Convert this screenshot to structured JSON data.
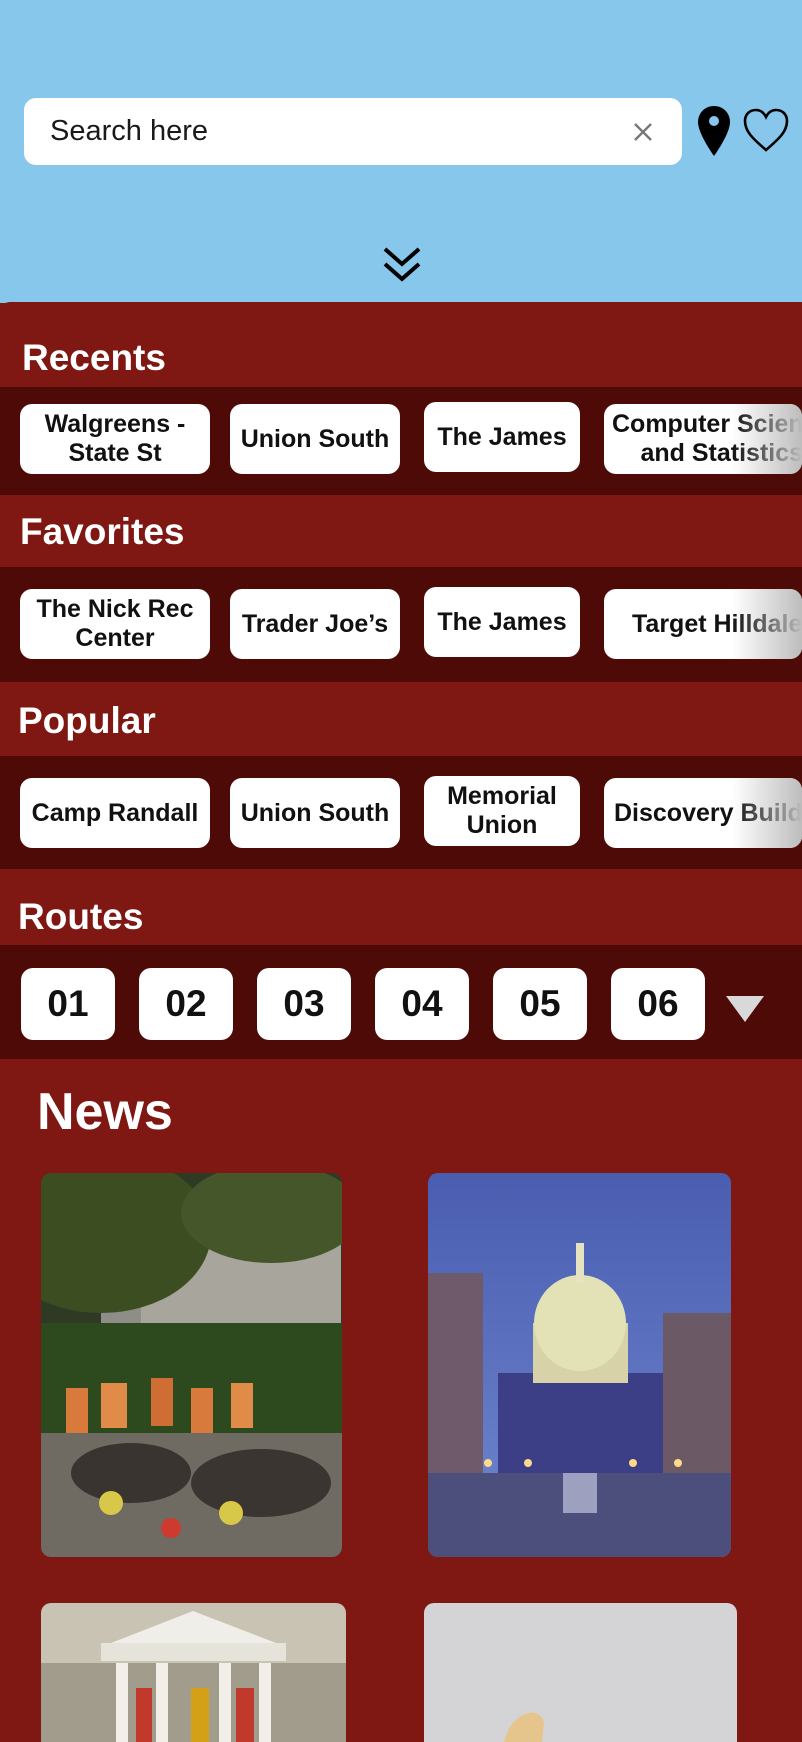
{
  "search": {
    "placeholder": "Search here"
  },
  "sections": {
    "recents": {
      "title": "Recents",
      "items": [
        "Walgreens -\nState St",
        "Union South",
        "The James",
        "Computer Science\nand Statistics"
      ]
    },
    "favorites": {
      "title": "Favorites",
      "items": [
        "The Nick Rec\nCenter",
        "Trader Joe’s",
        "The James",
        "Target Hilldale"
      ]
    },
    "popular": {
      "title": "Popular",
      "items": [
        "Camp Randall",
        "Union South",
        "Memorial\nUnion",
        "Discovery Building"
      ]
    },
    "routes": {
      "title": "Routes",
      "items": [
        "01",
        "02",
        "03",
        "04",
        "05",
        "06"
      ]
    }
  },
  "news": {
    "title": "News"
  },
  "colors": {
    "sky": "#87c7ec",
    "maroon": "#7f1712",
    "dark_band": "#4e0a07"
  },
  "icons": [
    "close-icon",
    "location-pin-icon",
    "heart-icon",
    "double-chevron-down-icon",
    "dropdown-triangle-icon"
  ]
}
